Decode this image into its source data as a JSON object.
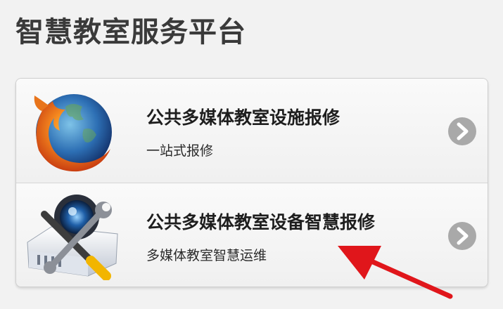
{
  "page": {
    "title": "智慧教室服务平台"
  },
  "services": [
    {
      "title": "公共多媒体教室设施报修",
      "subtitle": "一站式报修",
      "icon": "firefox-globe-icon"
    },
    {
      "title": "公共多媒体教室设备智慧报修",
      "subtitle": "多媒体教室智慧运维",
      "icon": "projector-tools-icon"
    }
  ],
  "colors": {
    "background": "#f2f2f2",
    "chevron": "#a9a9a9",
    "annotation": "#e0161b"
  }
}
